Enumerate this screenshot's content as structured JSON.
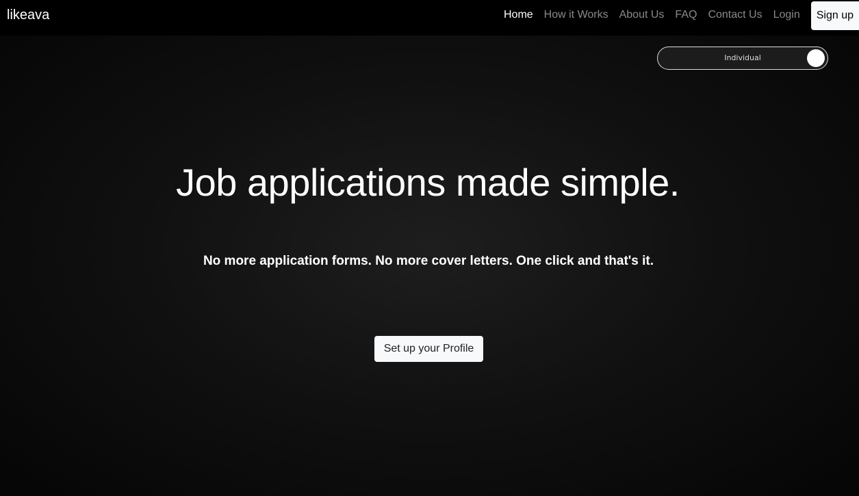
{
  "nav": {
    "brand": "likeava",
    "links": [
      "Home",
      "How it Works",
      "About Us",
      "FAQ",
      "Contact Us",
      "Login"
    ],
    "signup": "Sign up"
  },
  "toggle": {
    "label": "Individual"
  },
  "hero": {
    "title": "Job applications made simple.",
    "subtitle": "No more application forms. No more cover letters. One click and that's it.",
    "cta": "Set up your Profile"
  }
}
